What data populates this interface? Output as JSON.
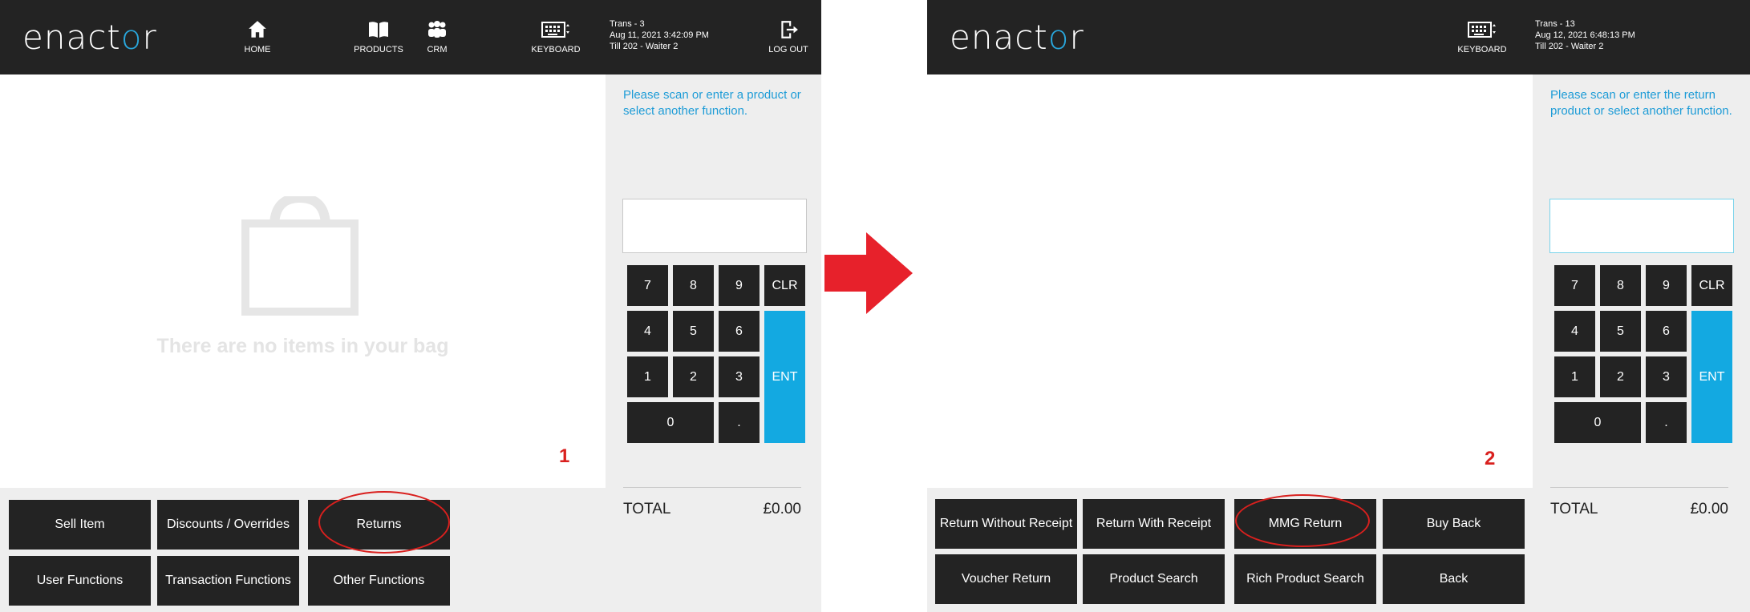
{
  "brand": {
    "logo_prefix": "enact",
    "logo_o": "o",
    "logo_suffix": "r",
    "accent": "#29a7dd"
  },
  "screen1": {
    "nav": {
      "home": "HOME",
      "products": "PRODUCTS",
      "crm": "CRM",
      "keyboard": "KEYBOARD",
      "logout": "LOG OUT"
    },
    "trans": {
      "line1": "Trans - 3",
      "line2": "Aug 11, 2021 3:42:09 PM",
      "line3": "Till 202 - Waiter 2"
    },
    "empty_message": "There are no items in your bag",
    "prompt": "Please scan or enter a product or select another function.",
    "keypad": {
      "k7": "7",
      "k8": "8",
      "k9": "9",
      "clr": "CLR",
      "k4": "4",
      "k5": "5",
      "k6": "6",
      "ent": "ENT",
      "k1": "1",
      "k2": "2",
      "k3": "3",
      "k0": "0",
      "dot": "."
    },
    "total_label": "TOTAL",
    "total_value": "£0.00",
    "functions": {
      "sell_item": "Sell Item",
      "discounts": "Discounts / Overrides",
      "returns": "Returns",
      "user_functions": "User Functions",
      "transaction_functions": "Transaction Functions",
      "other_functions": "Other Functions"
    },
    "step_number": "1"
  },
  "screen2": {
    "nav": {
      "keyboard": "KEYBOARD"
    },
    "trans": {
      "line1": "Trans - 13",
      "line2": "Aug 12, 2021 6:48:13 PM",
      "line3": "Till 202 - Waiter 2"
    },
    "prompt": "Please scan or enter the return product or select another function.",
    "keypad": {
      "k7": "7",
      "k8": "8",
      "k9": "9",
      "clr": "CLR",
      "k4": "4",
      "k5": "5",
      "k6": "6",
      "ent": "ENT",
      "k1": "1",
      "k2": "2",
      "k3": "3",
      "k0": "0",
      "dot": "."
    },
    "total_label": "TOTAL",
    "total_value": "£0.00",
    "functions": {
      "return_without_receipt": "Return Without Receipt",
      "return_with_receipt": "Return With Receipt",
      "mmg_return": "MMG Return",
      "buy_back": "Buy Back",
      "voucher_return": "Voucher Return",
      "product_search": "Product Search",
      "rich_product_search": "Rich Product Search",
      "back": "Back"
    },
    "step_number": "2"
  },
  "colors": {
    "header": "#232323",
    "key": "#232323",
    "ent": "#13a9e1",
    "prompt": "#1e9cd7",
    "annotation": "#d9201e"
  }
}
